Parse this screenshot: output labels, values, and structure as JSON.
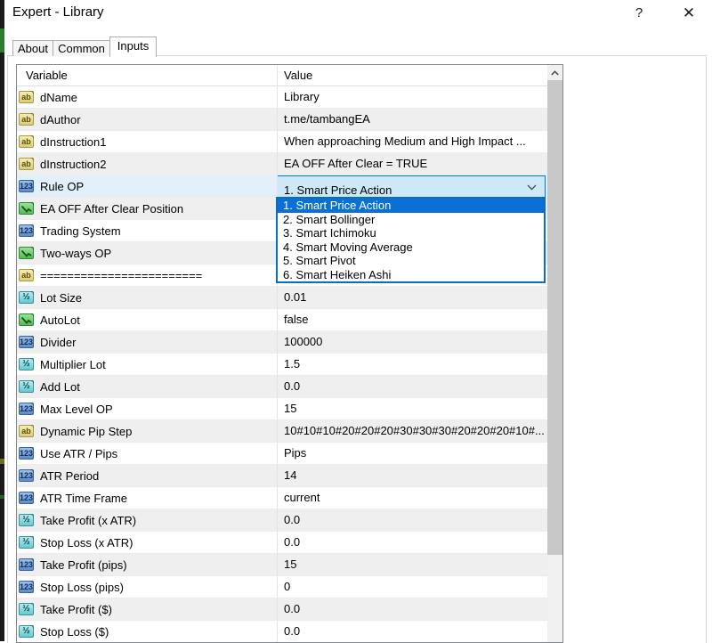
{
  "window": {
    "title": "Expert - Library",
    "help_glyph": "?",
    "close_glyph": "✕"
  },
  "tabs": [
    {
      "label": "About",
      "active": false
    },
    {
      "label": "Common",
      "active": false
    },
    {
      "label": "Inputs",
      "active": true
    }
  ],
  "table": {
    "col_variable": "Variable",
    "col_value": "Value",
    "rows": [
      {
        "name": "dName",
        "type": "string",
        "value": "Library"
      },
      {
        "name": "dAuthor",
        "type": "string",
        "value": "t.me/tambangEA"
      },
      {
        "name": "dInstruction1",
        "type": "string",
        "value": "When approaching Medium and High Impact ..."
      },
      {
        "name": "dInstruction2",
        "type": "string",
        "value": "EA OFF After Clear = TRUE"
      },
      {
        "name": "Rule OP",
        "type": "integer",
        "value": "1. Smart Price Action",
        "control": "dropdown",
        "selected": true
      },
      {
        "name": "EA OFF After Clear Position",
        "type": "boolean",
        "value": ""
      },
      {
        "name": "Trading System",
        "type": "integer",
        "value": ""
      },
      {
        "name": "Two-ways OP",
        "type": "boolean",
        "value": ""
      },
      {
        "name": "========================",
        "type": "string",
        "value": ""
      },
      {
        "name": "Lot Size",
        "type": "double",
        "value": "0.01"
      },
      {
        "name": "AutoLot",
        "type": "boolean",
        "value": "false"
      },
      {
        "name": "Divider",
        "type": "integer",
        "value": "100000"
      },
      {
        "name": "Multiplier Lot",
        "type": "double",
        "value": "1.5"
      },
      {
        "name": "Add Lot",
        "type": "double",
        "value": "0.0"
      },
      {
        "name": "Max Level OP",
        "type": "integer",
        "value": "15"
      },
      {
        "name": "Dynamic Pip Step",
        "type": "string",
        "value": "10#10#10#20#20#20#30#30#30#20#20#20#10#..."
      },
      {
        "name": "Use ATR / Pips",
        "type": "integer",
        "value": "Pips"
      },
      {
        "name": "ATR Period",
        "type": "integer",
        "value": "14"
      },
      {
        "name": "ATR Time Frame",
        "type": "integer",
        "value": "current"
      },
      {
        "name": "Take Profit (x ATR)",
        "type": "double",
        "value": "0.0"
      },
      {
        "name": "Stop Loss (x ATR)",
        "type": "double",
        "value": "0.0"
      },
      {
        "name": "Take Profit (pips)",
        "type": "integer",
        "value": "15"
      },
      {
        "name": "Stop Loss (pips)",
        "type": "integer",
        "value": "0"
      },
      {
        "name": "Take Profit ($)",
        "type": "double",
        "value": "0.0"
      },
      {
        "name": "Stop Loss ($)",
        "type": "double",
        "value": "0.0"
      }
    ]
  },
  "dropdown": {
    "selected": "1. Smart Price Action",
    "highlighted_index": 0,
    "options": [
      "1. Smart Price Action",
      "2. Smart Bollinger",
      "3. Smart Ichimoku",
      "4. Smart Moving Average",
      "5. Smart Pivot",
      "6. Smart Heiken Ashi"
    ]
  },
  "icons": {
    "string": "ab",
    "integer": "123",
    "double": "½",
    "boolean": "zigzag-line"
  },
  "colors": {
    "row_alt": "#efefef",
    "selected_row": "#e1f0fb",
    "combobox_bg": "#cde9f8",
    "accent_blue": "#0a70d6",
    "list_border": "#0a6ebd"
  }
}
